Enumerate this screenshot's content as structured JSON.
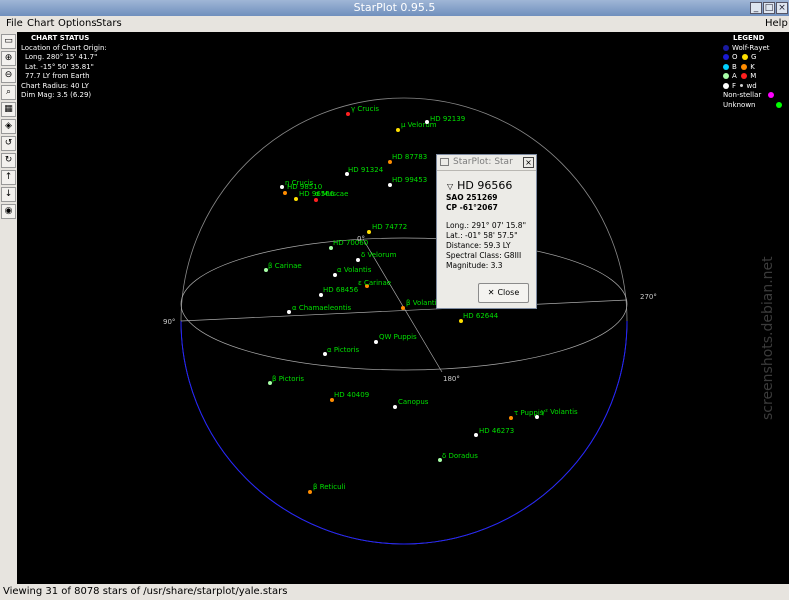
{
  "window": {
    "title": "StarPlot 0.95.5"
  },
  "menu": {
    "file": "File",
    "chart": "Chart",
    "options": "Options",
    "stars": "Stars",
    "help": "Help"
  },
  "chart_status": {
    "heading": "CHART STATUS",
    "line1": "Location of Chart Origin:",
    "line2": "Long. 280° 15' 41.7\"",
    "line3": "Lat. -15° 50' 35.81\"",
    "line4": "77.7 LY from Earth",
    "line5": "Chart Radius: 40 LY",
    "line6": "Dim Mag: 3.5 (6.29)"
  },
  "legend": {
    "heading": "LEGEND",
    "wr": "Wolf-Rayet",
    "o": "O",
    "g": "G",
    "b": "B",
    "k": "K",
    "a": "A",
    "m": "M",
    "f": "F",
    "wd": "wd",
    "nonstellar": "Non-stellar",
    "unknown": "Unknown",
    "colors": {
      "wr": "#1a1aa0",
      "o": "#1a1ad0",
      "g": "#ffe000",
      "b": "#00d0ff",
      "k": "#ff8c00",
      "a": "#a8ffa8",
      "m": "#ff2020",
      "f": "#ffffff",
      "wd": "#d0d0d0",
      "nonstellar": "#ff00ff",
      "unknown": "#00ff00"
    }
  },
  "axes": {
    "deg0": "0°",
    "deg90": "90°",
    "deg180": "180°",
    "deg270": "270°"
  },
  "stars": [
    {
      "name": "γ Crucis",
      "color": "#ff2020"
    },
    {
      "name": "μ Velorum",
      "color": "#ffe000"
    },
    {
      "name": "HD 92139",
      "color": "#ffffff"
    },
    {
      "name": "HD 87783",
      "color": "#ff8c00"
    },
    {
      "name": "HD 91324",
      "color": "#ffffff"
    },
    {
      "name": "HD 99453",
      "color": "#ffffff"
    },
    {
      "name": "η Crucis",
      "color": "#ffffff"
    },
    {
      "name": "HD 98510",
      "color": "#ff8c00"
    },
    {
      "name": "HD 96566",
      "color": "#ffe000"
    },
    {
      "name": "α Muscae",
      "color": "#ff2020"
    },
    {
      "name": "HD 74772",
      "color": "#ffe000"
    },
    {
      "name": "HD 70060",
      "color": "#a8ffa8"
    },
    {
      "name": "δ Velorum",
      "color": "#ffffff"
    },
    {
      "name": "β Carinae",
      "color": "#a8ffa8"
    },
    {
      "name": "α Volantis",
      "color": "#ffffff"
    },
    {
      "name": "ε Carinae",
      "color": "#ff8c00"
    },
    {
      "name": "HD 68456",
      "color": "#ffffff"
    },
    {
      "name": "β Volantis",
      "color": "#ff8c00"
    },
    {
      "name": "HD 62644",
      "color": "#ffe000"
    },
    {
      "name": "α Chamaeleontis",
      "color": "#ffffff"
    },
    {
      "name": "QW Puppis",
      "color": "#ffffff"
    },
    {
      "name": "α Pictoris",
      "color": "#ffffff"
    },
    {
      "name": "β Pictoris",
      "color": "#a8ffa8"
    },
    {
      "name": "HD 40409",
      "color": "#ff8c00"
    },
    {
      "name": "Canopus",
      "color": "#ffffff"
    },
    {
      "name": "τ Puppis",
      "color": "#ff8c00"
    },
    {
      "name": "γ² Volantis",
      "color": "#ffffff"
    },
    {
      "name": "HD 46273",
      "color": "#ffffff"
    },
    {
      "name": "δ Doradus",
      "color": "#a8ffa8"
    },
    {
      "name": "β Reticuli",
      "color": "#ff8c00"
    }
  ],
  "dialog": {
    "title": "StarPlot: Star",
    "star_name": "HD 96566",
    "sao": "SAO 251269",
    "cp": "CP -61°2067",
    "long": "Long.: 291° 07' 15.8\"",
    "lat": "Lat.: -01° 58' 57.5\"",
    "distance": "Distance: 59.3 LY",
    "spectral": "Spectral Class: G8III",
    "magnitude": "Magnitude: 3.3",
    "close": "Close"
  },
  "status": {
    "text": "Viewing 31 of 8078 stars of /usr/share/starplot/yale.stars"
  },
  "watermark": "screenshots.debian.net"
}
